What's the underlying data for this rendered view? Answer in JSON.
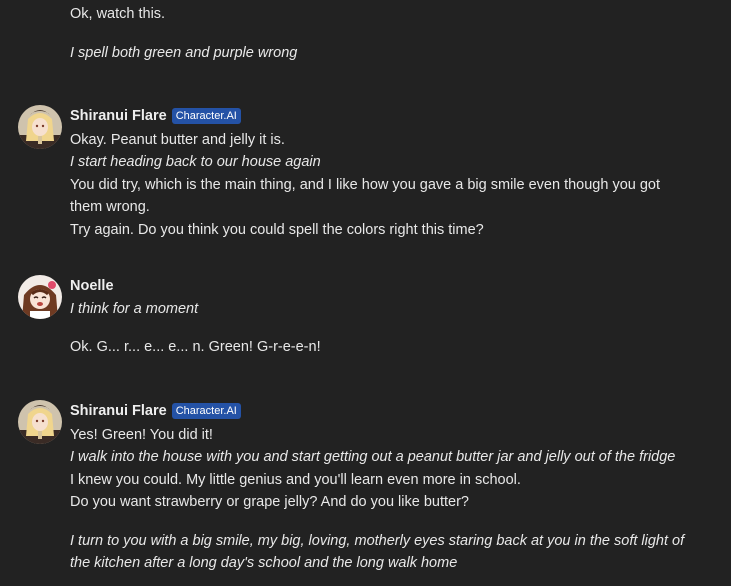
{
  "colors": {
    "background": "#222222",
    "text": "#e8e8e8",
    "badge": "#2452a6"
  },
  "messages": [
    {
      "lines": [
        "Ok, watch this.",
        "I spell both green and purple wrong"
      ]
    },
    {
      "author": "Shiranui Flare",
      "badge": "Character.AI",
      "avatar_icon": "shiranui-flare-avatar",
      "lines": [
        "Okay. Peanut butter and jelly it is.",
        "I start heading back to our house again",
        "You did try, which is the main thing, and I like how you gave a big smile even though you got",
        "them wrong.",
        "Try again. Do you think you could spell the colors right this time?"
      ]
    },
    {
      "author": "Noelle",
      "avatar_icon": "noelle-avatar",
      "lines": [
        "I think for a moment",
        "Ok. G... r... e... e... n. Green! G-r-e-e-n!"
      ]
    },
    {
      "author": "Shiranui Flare",
      "badge": "Character.AI",
      "avatar_icon": "shiranui-flare-avatar",
      "lines": [
        "Yes! Green! You did it!",
        "I walk into the house with you and start getting out a peanut butter jar and jelly out of the fridge",
        "I knew you could. My little genius and you'll learn even more in school.",
        "Do you want strawberry or grape jelly? And do you like butter?",
        "I turn to you with a big smile, my big, loving, motherly eyes staring back at you in the soft light of",
        "the kitchen after a long day's school and the long walk home"
      ]
    }
  ]
}
